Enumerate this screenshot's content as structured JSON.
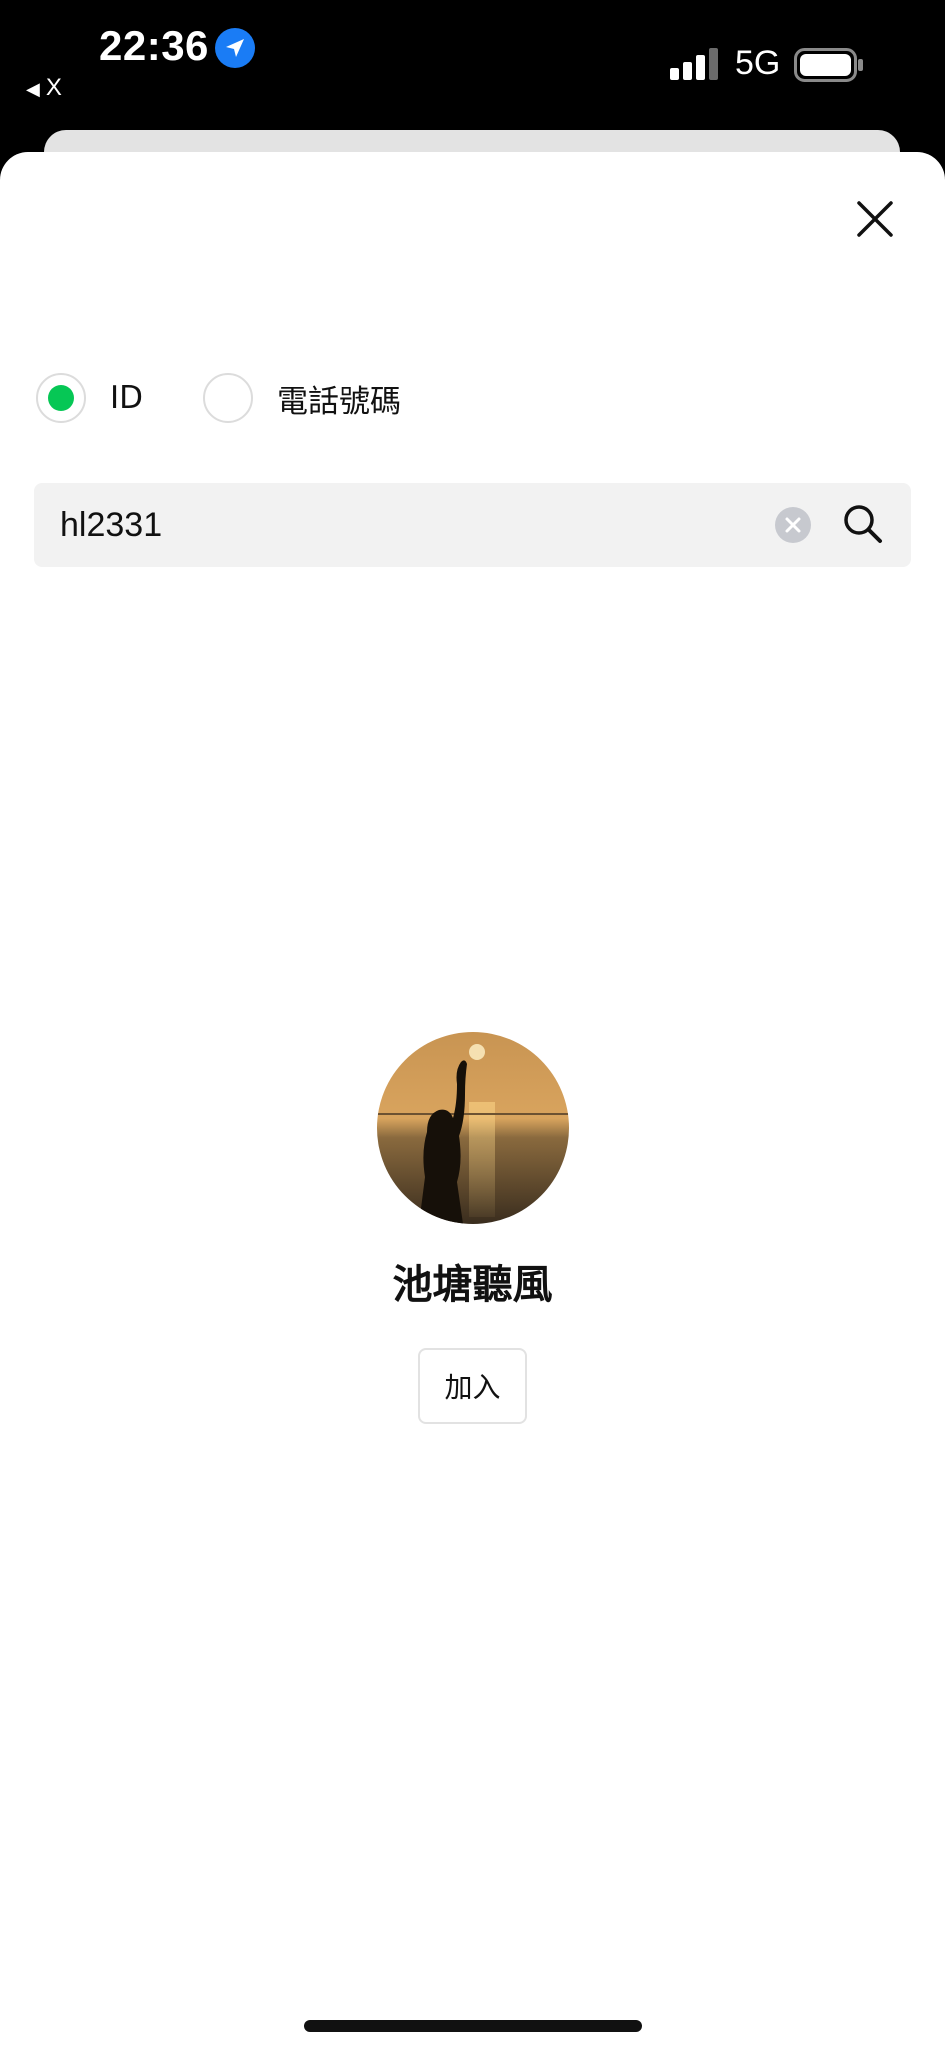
{
  "status_bar": {
    "time": "22:36",
    "back_app_label": "X",
    "network": "5G",
    "location_icon": "location-arrow-icon",
    "signal_icon": "cellular-signal-icon",
    "battery_icon": "battery-full-icon"
  },
  "sheet": {
    "close_icon": "close-icon"
  },
  "search_type": {
    "options": [
      {
        "label": "ID",
        "selected": true
      },
      {
        "label": "電話號碼",
        "selected": false
      }
    ],
    "selected_color": "#06c755"
  },
  "search": {
    "value": "hl2331",
    "clear_icon": "clear-circle-icon",
    "search_icon": "search-icon"
  },
  "result": {
    "name": "池塘聽風",
    "add_label": "加入"
  }
}
